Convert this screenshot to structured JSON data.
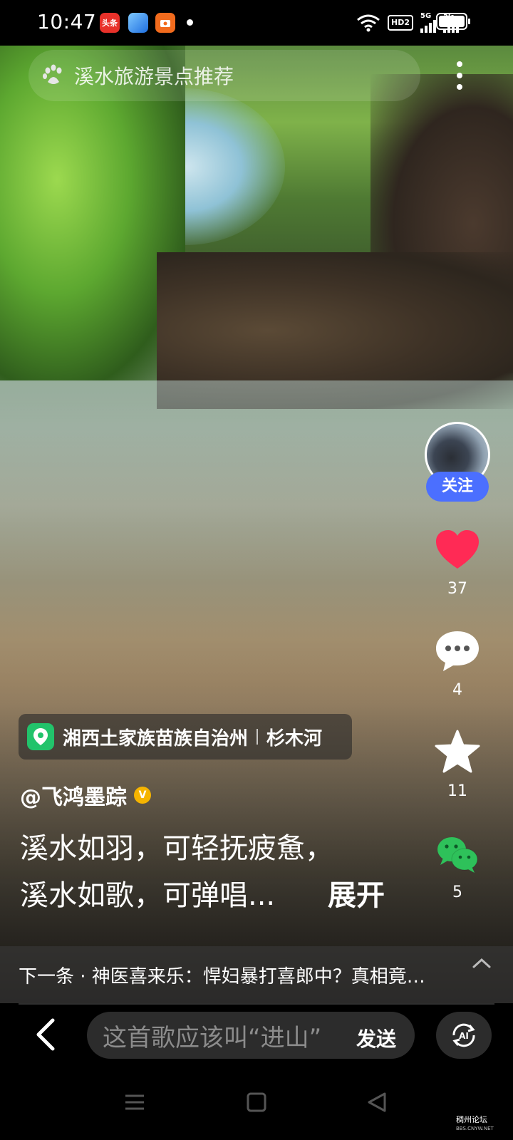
{
  "status_bar": {
    "time": "10:47",
    "app_badges": [
      "头条"
    ],
    "network": "5G",
    "network_2": "5G",
    "hd_label": "HD2"
  },
  "search": {
    "query": "溪水旅游景点推荐"
  },
  "rail": {
    "follow_label": "关注",
    "likes": "37",
    "comments": "4",
    "favorites": "11",
    "shares": "5",
    "like_color": "#ff2a55"
  },
  "post": {
    "location_region": "湘西土家族苗族自治州",
    "location_place": "杉木河",
    "author": "@飞鸿墨踪",
    "caption_line1": "溪水如羽，可轻抚疲惫，",
    "caption_line2": "溪水如歌，可弹唱...",
    "expand_label": "展开"
  },
  "next": {
    "text": "下一条 · 神医喜来乐：悍妇暴打喜郎中？真相竟然是这样"
  },
  "input": {
    "placeholder": "这首歌应该叫“进山”",
    "send_label": "发送",
    "ai_label": "AI"
  },
  "watermark": {
    "name": "稠州论坛",
    "url": "BBS.CNYW.NET"
  },
  "colors": {
    "follow_bg": "#4b6fff",
    "location_icon_bg": "#22c36b",
    "share_green": "#2ec15a"
  }
}
